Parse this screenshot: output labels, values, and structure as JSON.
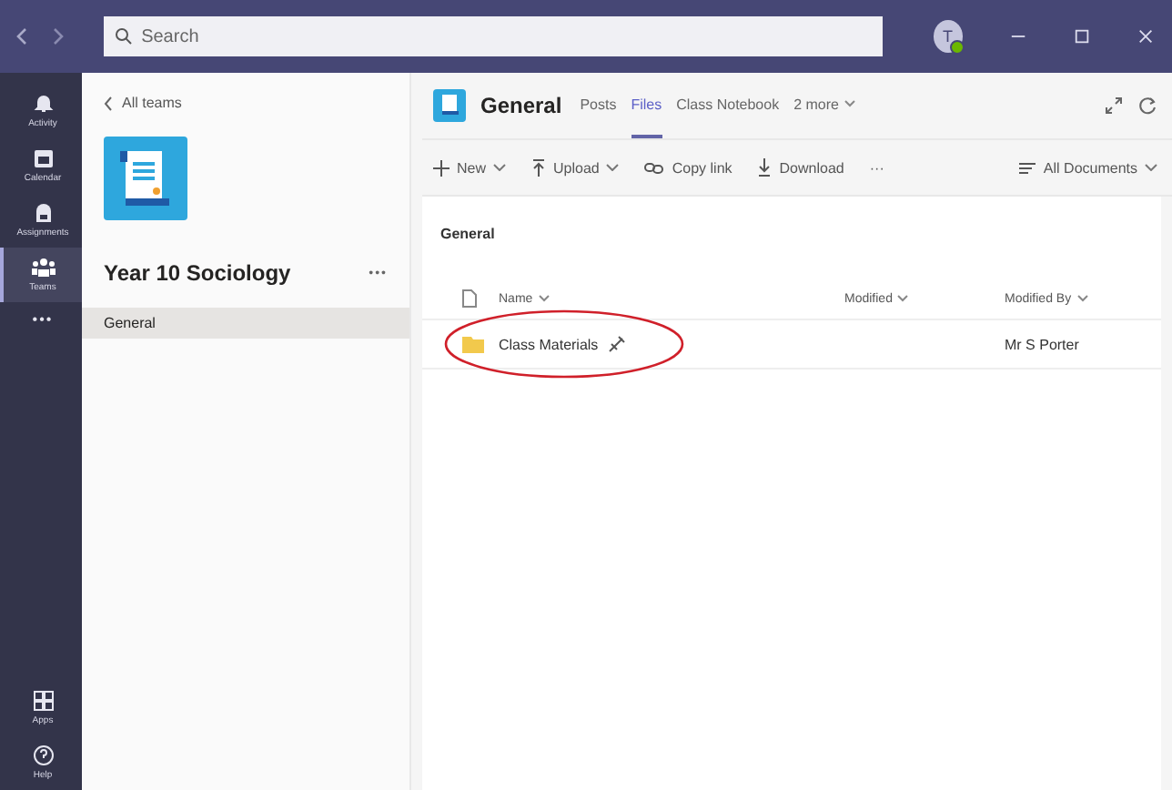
{
  "titlebar": {
    "search_placeholder": "Search",
    "avatar_initial": "T"
  },
  "rail": [
    {
      "label": "Activity",
      "kind": "bell",
      "selected": false
    },
    {
      "label": "Calendar",
      "kind": "calendar",
      "selected": false
    },
    {
      "label": "Assignments",
      "kind": "bag",
      "selected": false
    },
    {
      "label": "Teams",
      "kind": "teams",
      "selected": true
    },
    {
      "label": "•••",
      "kind": "more",
      "selected": false
    }
  ],
  "rail_bottom": [
    {
      "label": "Apps",
      "kind": "apps"
    },
    {
      "label": "Help",
      "kind": "help"
    }
  ],
  "team_panel": {
    "back_link": "All teams",
    "team_name": "Year 10 Sociology",
    "more": "•••",
    "channels": [
      {
        "name": "General",
        "selected": true
      }
    ]
  },
  "channel_header": {
    "name": "General",
    "tabs": [
      {
        "label": "Posts",
        "selected": false
      },
      {
        "label": "Files",
        "selected": true
      },
      {
        "label": "Class Notebook",
        "selected": false
      },
      {
        "label": "2 more",
        "selected": false
      }
    ]
  },
  "toolbar": [
    {
      "label": "New",
      "kind": "plus",
      "caret": true
    },
    {
      "label": "Upload",
      "kind": "upload",
      "caret": true
    },
    {
      "label": "Copy link",
      "kind": "link",
      "caret": false
    },
    {
      "label": "Download",
      "kind": "download",
      "caret": false
    },
    {
      "label": "···",
      "kind": "more",
      "caret": false
    }
  ],
  "view_selector": "All Documents",
  "breadcrumb": "General",
  "table": {
    "columns": [
      "Name",
      "Modified",
      "Modified By"
    ],
    "rows": [
      {
        "name": "Class Materials",
        "modified_by": "Mr S Porter",
        "highlighted": true
      }
    ]
  }
}
